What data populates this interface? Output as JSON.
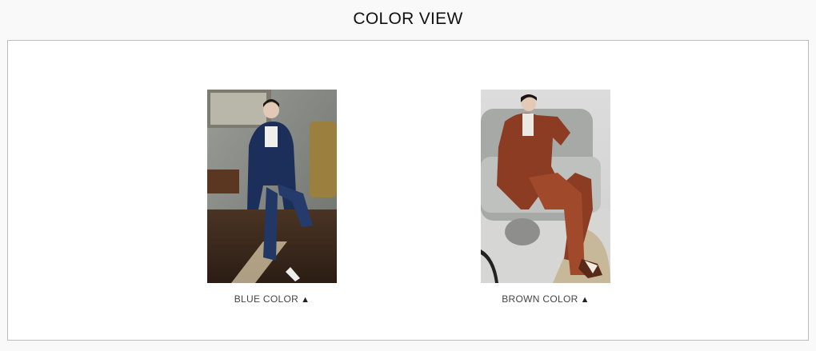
{
  "section": {
    "title": "COLOR VIEW"
  },
  "colors": [
    {
      "label": "BLUE COLOR",
      "indicator": "▲",
      "accent": "#1f3a66"
    },
    {
      "label": "BROWN COLOR",
      "indicator": "▲",
      "accent": "#9a4a2a"
    }
  ]
}
